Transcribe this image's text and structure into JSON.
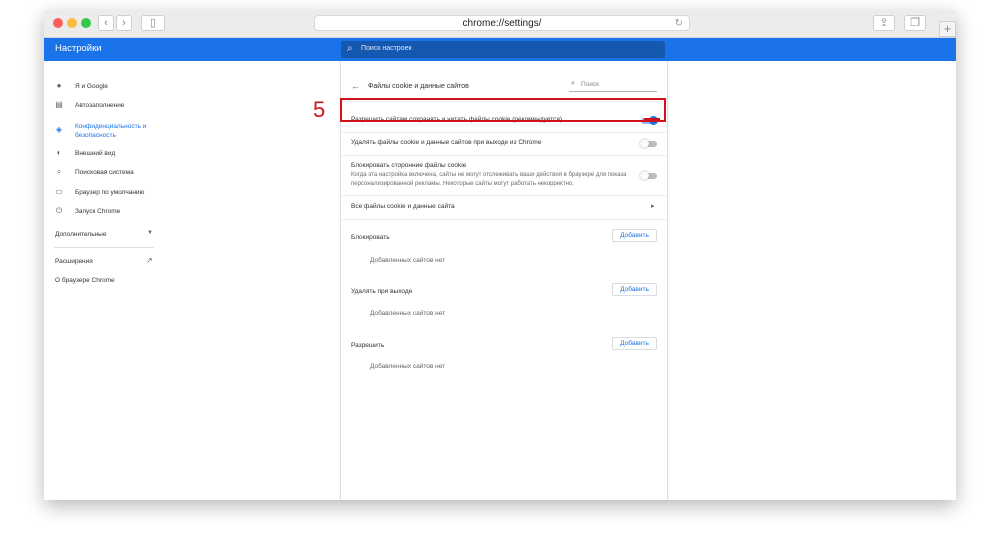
{
  "browser": {
    "url": "chrome://settings/",
    "traffic_lights": [
      "#fc605c",
      "#fdbc40",
      "#34c84a"
    ]
  },
  "app": {
    "title": "Настройки",
    "search_placeholder": "Поиск настроек",
    "accent": "#1a73e8"
  },
  "sidebar": {
    "items": [
      {
        "label": "Я и Google",
        "icon": "person-icon"
      },
      {
        "label": "Автозаполнение",
        "icon": "clipboard-icon"
      },
      {
        "label": "Конфиденциальность и безопасность",
        "icon": "shield-icon",
        "active": true
      },
      {
        "label": "Внешний вид",
        "icon": "palette-icon"
      },
      {
        "label": "Поисковая система",
        "icon": "search-icon"
      },
      {
        "label": "Браузер по умолчанию",
        "icon": "browser-icon"
      },
      {
        "label": "Запуск Chrome",
        "icon": "power-icon"
      }
    ],
    "advanced_label": "Дополнительные",
    "extensions_label": "Расширения",
    "about_label": "О браузере Chrome"
  },
  "content": {
    "title": "Файлы cookie и данные сайтов",
    "search_placeholder": "Поиск",
    "settings": [
      {
        "label": "Разрешить сайтам сохранять и читать файлы cookie (рекомендуется)",
        "enabled": true
      },
      {
        "label": "Удалять файлы cookie и данные сайтов при выходе из Chrome",
        "enabled": false
      },
      {
        "label": "Блокировать сторонние файлы cookie",
        "description": "Когда эта настройка включена, сайты не могут отслеживать ваши действия в браузере для показа персонализированной рекламы. Некоторые сайты могут работать некорректно.",
        "enabled": false
      }
    ],
    "all_cookies_label": "Все файлы cookie и данные сайта",
    "sections": [
      {
        "label": "Блокировать",
        "button": "Добавить",
        "empty": "Добавленных сайтов нет"
      },
      {
        "label": "Удалять при выходе",
        "button": "Добавить",
        "empty": "Добавленных сайтов нет"
      },
      {
        "label": "Разрешить",
        "button": "Добавить",
        "empty": "Добавленных сайтов нет"
      }
    ]
  },
  "annotation": {
    "step_number": "5",
    "color": "#d1111c"
  }
}
